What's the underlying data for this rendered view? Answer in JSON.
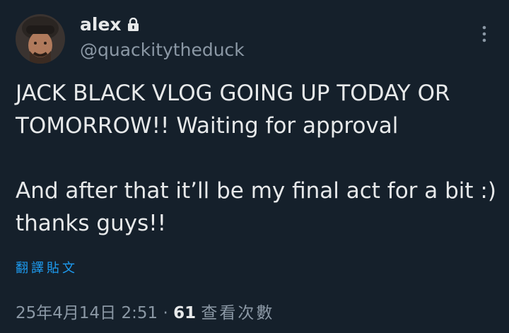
{
  "author": {
    "display_name": "alex",
    "handle": "@quackitytheduck",
    "avatar_icon": "user-avatar",
    "protected_icon": "lock-icon"
  },
  "tweet": {
    "text": "JACK BLACK VLOG GOING UP TODAY OR TOMORROW!! Waiting for approval\n\nAnd after that it’ll be my final act for a bit :) thanks guys!!",
    "translate_label": "翻譯貼文"
  },
  "meta": {
    "date": "25年4月14日",
    "time": "2:51",
    "separator": " · ",
    "views": "61",
    "views_label": "查看次數"
  },
  "colors": {
    "background": "#15202b",
    "primary_text": "#e7e9ea",
    "secondary_text": "#8b98a5",
    "accent": "#1d9bf0"
  }
}
